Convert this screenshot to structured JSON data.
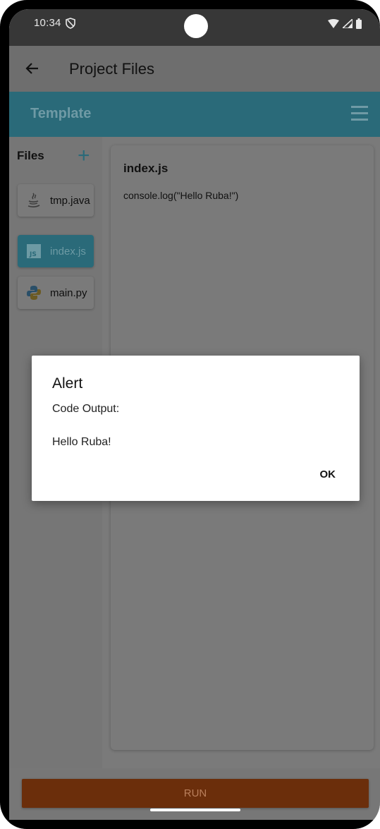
{
  "status_bar": {
    "time": "10:34"
  },
  "app_bar": {
    "title": "Project Files"
  },
  "template_bar": {
    "title": "Template"
  },
  "sidebar": {
    "title": "Files",
    "add_symbol": "+",
    "files": [
      {
        "name": "tmp.java",
        "icon": "java-icon",
        "active": false
      },
      {
        "name": "index.js",
        "icon": "js-icon",
        "active": true
      },
      {
        "name": "main.py",
        "icon": "python-icon",
        "active": false
      }
    ]
  },
  "editor": {
    "filename": "index.js",
    "code": "console.log(\"Hello Ruba!\")"
  },
  "run_button": {
    "label": "RUN"
  },
  "dialog": {
    "title": "Alert",
    "line1": "Code Output:",
    "line2": "Hello Ruba!",
    "ok_label": "OK"
  },
  "colors": {
    "accent": "#2a6a79",
    "run": "#6b2e0b"
  }
}
